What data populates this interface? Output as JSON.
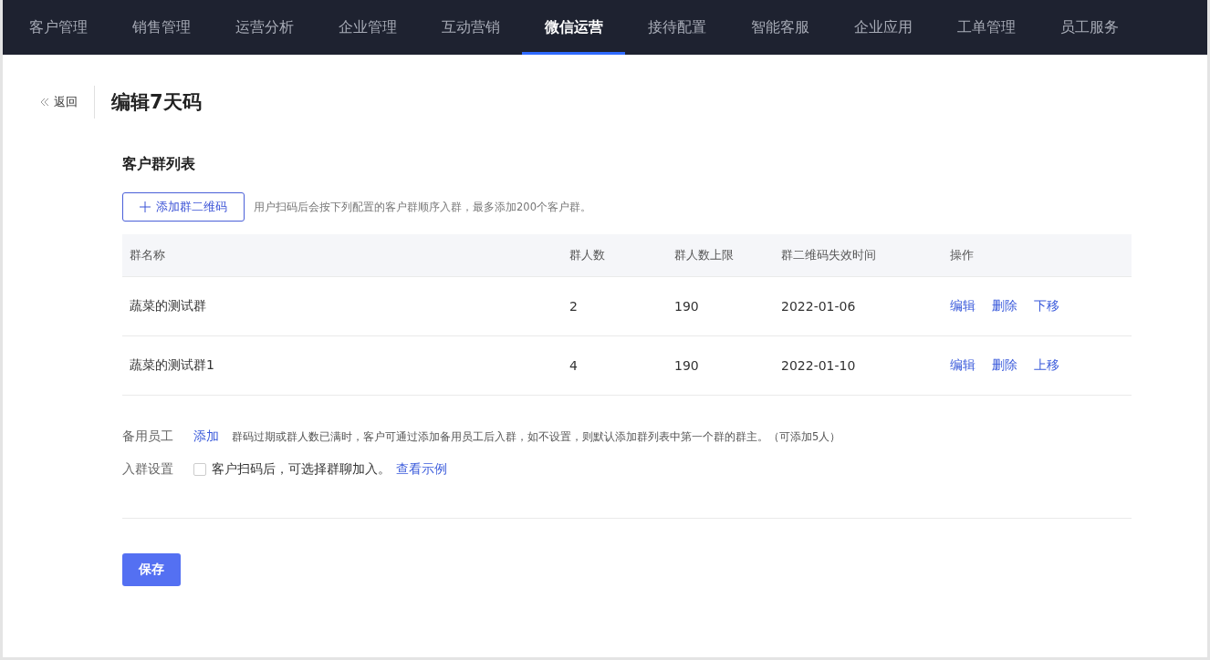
{
  "nav": [
    {
      "label": "客户管理",
      "selected": false
    },
    {
      "label": "销售管理",
      "selected": false
    },
    {
      "label": "运营分析",
      "selected": false
    },
    {
      "label": "企业管理",
      "selected": false
    },
    {
      "label": "互动营销",
      "selected": false
    },
    {
      "label": "微信运营",
      "selected": true
    },
    {
      "label": "接待配置",
      "selected": false
    },
    {
      "label": "智能客服",
      "selected": false
    },
    {
      "label": "企业应用",
      "selected": false
    },
    {
      "label": "工单管理",
      "selected": false
    },
    {
      "label": "员工服务",
      "selected": false
    }
  ],
  "back": "返回",
  "title": "编辑7天码",
  "section_title": "客户群列表",
  "add_button": "添加群二维码",
  "add_hint": "用户扫码后会按下列配置的客户群顺序入群，最多添加200个客户群。",
  "table": {
    "columns": [
      "群名称",
      "群人数",
      "群人数上限",
      "群二维码失效时间",
      "操作"
    ],
    "rows": [
      {
        "cells": [
          "蔬菜的测试群",
          "2",
          "190",
          "2022-01-06"
        ],
        "actions": [
          "编辑",
          "删除",
          "下移"
        ]
      },
      {
        "cells": [
          "蔬菜的测试群1",
          "4",
          "190",
          "2022-01-10"
        ],
        "actions": [
          "编辑",
          "删除",
          "上移"
        ]
      }
    ]
  },
  "backup_staff": {
    "label": "备用员工",
    "link": "添加",
    "hint": "群码过期或群人数已满时，客户可通过添加备用员工后入群，如不设置，则默认添加群列表中第一个群的群主。（可添加5人）"
  },
  "join_setting": {
    "label": "入群设置",
    "checked": false,
    "option": "客户扫码后，可选择群聊加入。",
    "link": "查看示例"
  },
  "save_button": "保存"
}
